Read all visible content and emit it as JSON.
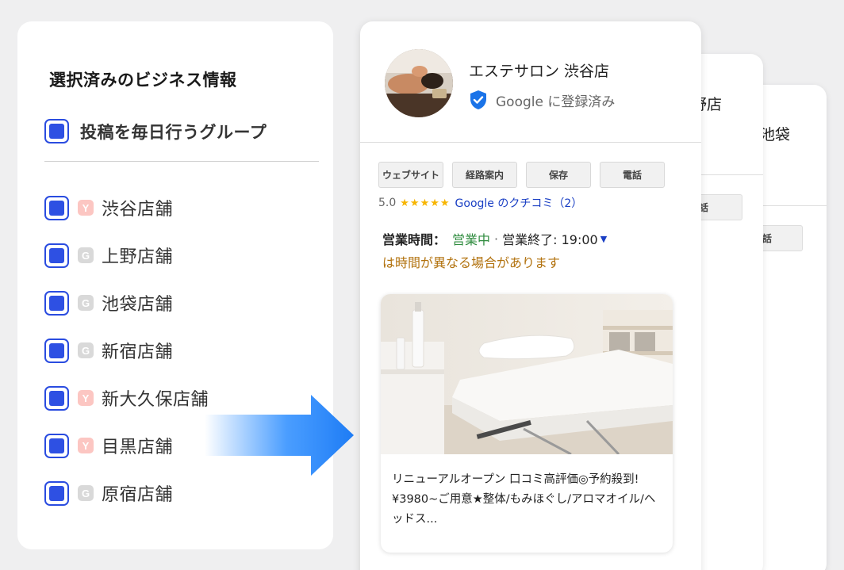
{
  "left_panel": {
    "title": "選択済みのビジネス情報",
    "group_label": "投稿を毎日行うグループ",
    "stores": [
      {
        "name": "渋谷店舗",
        "source": "Y"
      },
      {
        "name": "上野店舗",
        "source": "G"
      },
      {
        "name": "池袋店舗",
        "source": "G"
      },
      {
        "name": "新宿店舗",
        "source": "G"
      },
      {
        "name": "新大久保店舗",
        "source": "Y"
      },
      {
        "name": "目黒店舗",
        "source": "Y"
      },
      {
        "name": "原宿店舗",
        "source": "G"
      }
    ]
  },
  "back_cards": [
    {
      "title_fragment": "野店",
      "button_label": "電話"
    },
    {
      "title_fragment": "池袋",
      "button_label": "電話"
    }
  ],
  "business_card": {
    "title": "エステサロン 渋谷店",
    "verified_label": "Google に登録済み",
    "actions": [
      "ウェブサイト",
      "経路案内",
      "保存",
      "電話"
    ],
    "rating_value": "5.0",
    "stars": "★★★★★",
    "review_link": "Google のクチコミ（2）",
    "hours_label": "営業時間：",
    "open_status": "営業中",
    "separator": "·",
    "closing_time": "営業終了: 19:00",
    "hours_note": "は時間が異なる場合があります",
    "post_text": "リニューアルオープン  口コミ高評価◎予約殺到!¥3980~ご用意★整体/もみほぐし/アロマオイル/ヘッドス..."
  },
  "colors": {
    "checkbox_blue": "#2e50e3",
    "badge_y": "#fcc6c2",
    "badge_g": "#d9d9d9",
    "open_green": "#2e8b3e",
    "note_orange": "#b2720e",
    "link_blue": "#1a3fc4",
    "star_yellow": "#f7b500",
    "arrow_blue": "#2a8cff"
  }
}
